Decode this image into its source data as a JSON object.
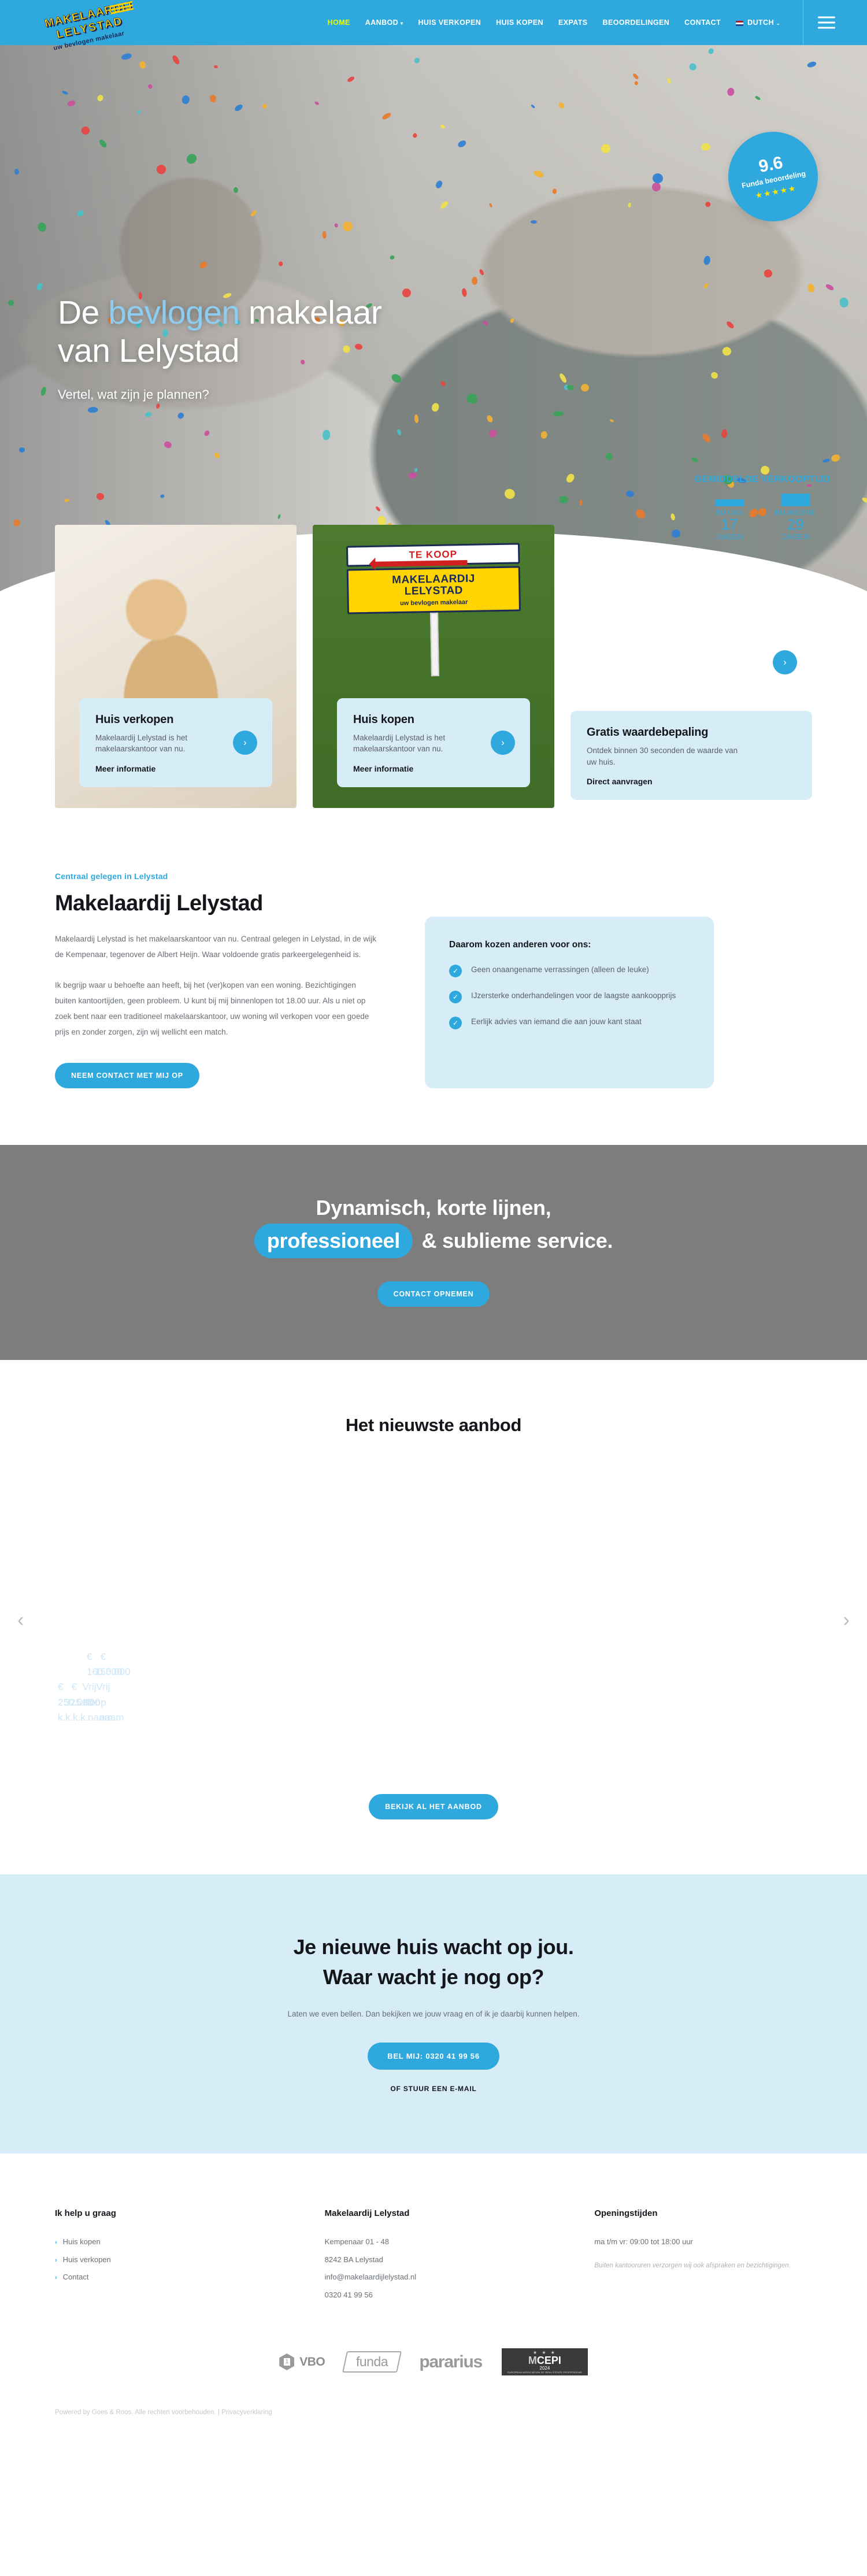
{
  "header": {
    "logo": {
      "line1": "MAKELAARDIJ",
      "line2": "LELYSTAD",
      "line3": "uw bevlogen makelaar"
    },
    "nav": [
      {
        "label": "HOME",
        "active": true
      },
      {
        "label": "AANBOD",
        "caret": "▾"
      },
      {
        "label": "HUIS VERKOPEN"
      },
      {
        "label": "HUIS KOPEN"
      },
      {
        "label": "EXPATS"
      },
      {
        "label": "BEOORDELINGEN"
      },
      {
        "label": "CONTACT"
      }
    ],
    "lang": {
      "label": "DUTCH",
      "caret": "⌄"
    },
    "menu_icon": "hamburger-icon"
  },
  "hero": {
    "title_pre": "De ",
    "title_hl": "bevlogen",
    "title_post": " makelaar",
    "title_line2": "van Lelystad",
    "subtitle": "Vertel, wat zijn je plannen?",
    "badge": {
      "score": "9.6",
      "caption": "Funda beoordeling",
      "stars": "★★★★★"
    },
    "stats": {
      "title": "GEMIDDELDE VERKOOPTIJD",
      "cols": [
        {
          "label": "BIJ ONS",
          "value": "17",
          "unit": "DAGEN"
        },
        {
          "label": "BIJ ANDERE",
          "value": "29",
          "unit": "DAGEN"
        }
      ]
    }
  },
  "cards": [
    {
      "title": "Huis verkopen",
      "text": "Makelaardij Lelystad is het makelaarskantoor van nu.",
      "link": "Meer informatie",
      "arrow": "›"
    },
    {
      "title": "Huis kopen",
      "text": "Makelaardij Lelystad is het makelaarskantoor van nu.",
      "link": "Meer informatie",
      "arrow": "›",
      "sign": {
        "top": "TE KOOP",
        "mid1": "MAKELAARDIJ",
        "mid2": "LELYSTAD",
        "sub": "uw bevlogen makelaar"
      }
    },
    {
      "title": "Gratis waardebepaling",
      "text": "Ontdek binnen 30 seconden de waarde van uw huis.",
      "link": "Direct aanvragen",
      "arrow": "›"
    }
  ],
  "intro": {
    "eyebrow": "Centraal gelegen in Lelystad",
    "heading": "Makelaardij Lelystad",
    "p1": "Makelaardij Lelystad is het makelaarskantoor van nu. Centraal gelegen in Lelystad, in de wijk de Kempenaar, tegenover de Albert Heijn. Waar voldoende gratis parkeergelegenheid is.",
    "p2": "Ik begrijp waar u behoefte aan heeft, bij het (ver)kopen van een woning. Bezichtigingen buiten kantoortijden, geen probleem. U kunt bij mij binnenlopen tot 18.00 uur. Als u niet op zoek bent naar een traditioneel makelaarskantoor, uw woning wil verkopen voor een goede prijs en zonder zorgen, zijn wij wellicht een match.",
    "cta": "NEEM CONTACT MET MIJ OP",
    "reasons": {
      "title": "Daarom kozen anderen voor ons:",
      "items": [
        "Geen onaangename verrassingen (alleen de leuke)",
        "IJzersterke onderhandelingen voor de laagste aankoopprijs",
        "Eerlijk advies van iemand die aan jouw kant staat"
      ],
      "tick": "✓"
    }
  },
  "banner": {
    "line1": "Dynamisch, korte lijnen,",
    "pill": "professioneel",
    "line2_rest": " & sublieme service.",
    "cta": "CONTACT OPNEMEN"
  },
  "aanbod": {
    "heading": "Het nieuwste aanbod",
    "prev_icon": "chevron-left-icon",
    "next_icon": "chevron-right-icon",
    "prev": "‹",
    "next": "›",
    "placeholder": {
      "r1a": "€",
      "r1b": "€",
      "r2a": "160.000",
      "r2b": "155.000",
      "r3a": "€",
      "r3b": "€",
      "r3c": "Vrij",
      "r3d": "Vrij",
      "r4a": "250.000",
      "r4b": "325.000",
      "r4c": "Koop",
      "r5a": "k.k.",
      "r5b": "k.k.",
      "r5c": "naam",
      "r5d": "naam"
    },
    "cta": "BEKIJK AL HET AANBOD"
  },
  "cta_section": {
    "line1": "Je nieuwe huis wacht op jou.",
    "line2": "Waar wacht je nog op?",
    "text": "Laten we even bellen. Dan bekijken we jouw vraag en of ik je daarbij kunnen helpen.",
    "button": "BEL MIJ: 0320 41 99 56",
    "email_link": "OF STUUR EEN E-MAIL"
  },
  "footer": {
    "col1": {
      "title": "Ik help u graag",
      "chev": "›",
      "links": [
        "Huis kopen",
        "Huis verkopen",
        "Contact"
      ]
    },
    "col2": {
      "title": "Makelaardij Lelystad",
      "lines": [
        "Kempenaar 01 - 48",
        "8242 BA Lelystad",
        "info@makelaardijlelystad.nl",
        "0320 41 99 56"
      ]
    },
    "col3": {
      "title": "Openingstijden",
      "hours": "ma t/m vr: 09:00 tot 18:00 uur",
      "note": "Buiten kantooruren verzorgen wij ook afspraken en bezichtigingen."
    },
    "partners": [
      {
        "name": "vbo-logo",
        "text": "VBO"
      },
      {
        "name": "funda-logo",
        "text": "funda"
      },
      {
        "name": "pararius-logo",
        "text": "pararius"
      },
      {
        "name": "cepi-logo",
        "stars": "★ ★ ★",
        "m": "M",
        "cepi": "CEPI",
        "year": "2024",
        "small": "EUROPEAN ASSOCIATION OF REAL ESTATE PROFESSIONS"
      }
    ],
    "copyright": "Powered by Goes & Roos. Alle rechten voorbehouden. | ",
    "privacy": "Privacyverklaring"
  },
  "colors": {
    "brand": "#2fa8dd",
    "accent_yellow": "#eaff00",
    "pale_blue": "#d6ecf7",
    "grey_band": "#7d7d7d"
  }
}
